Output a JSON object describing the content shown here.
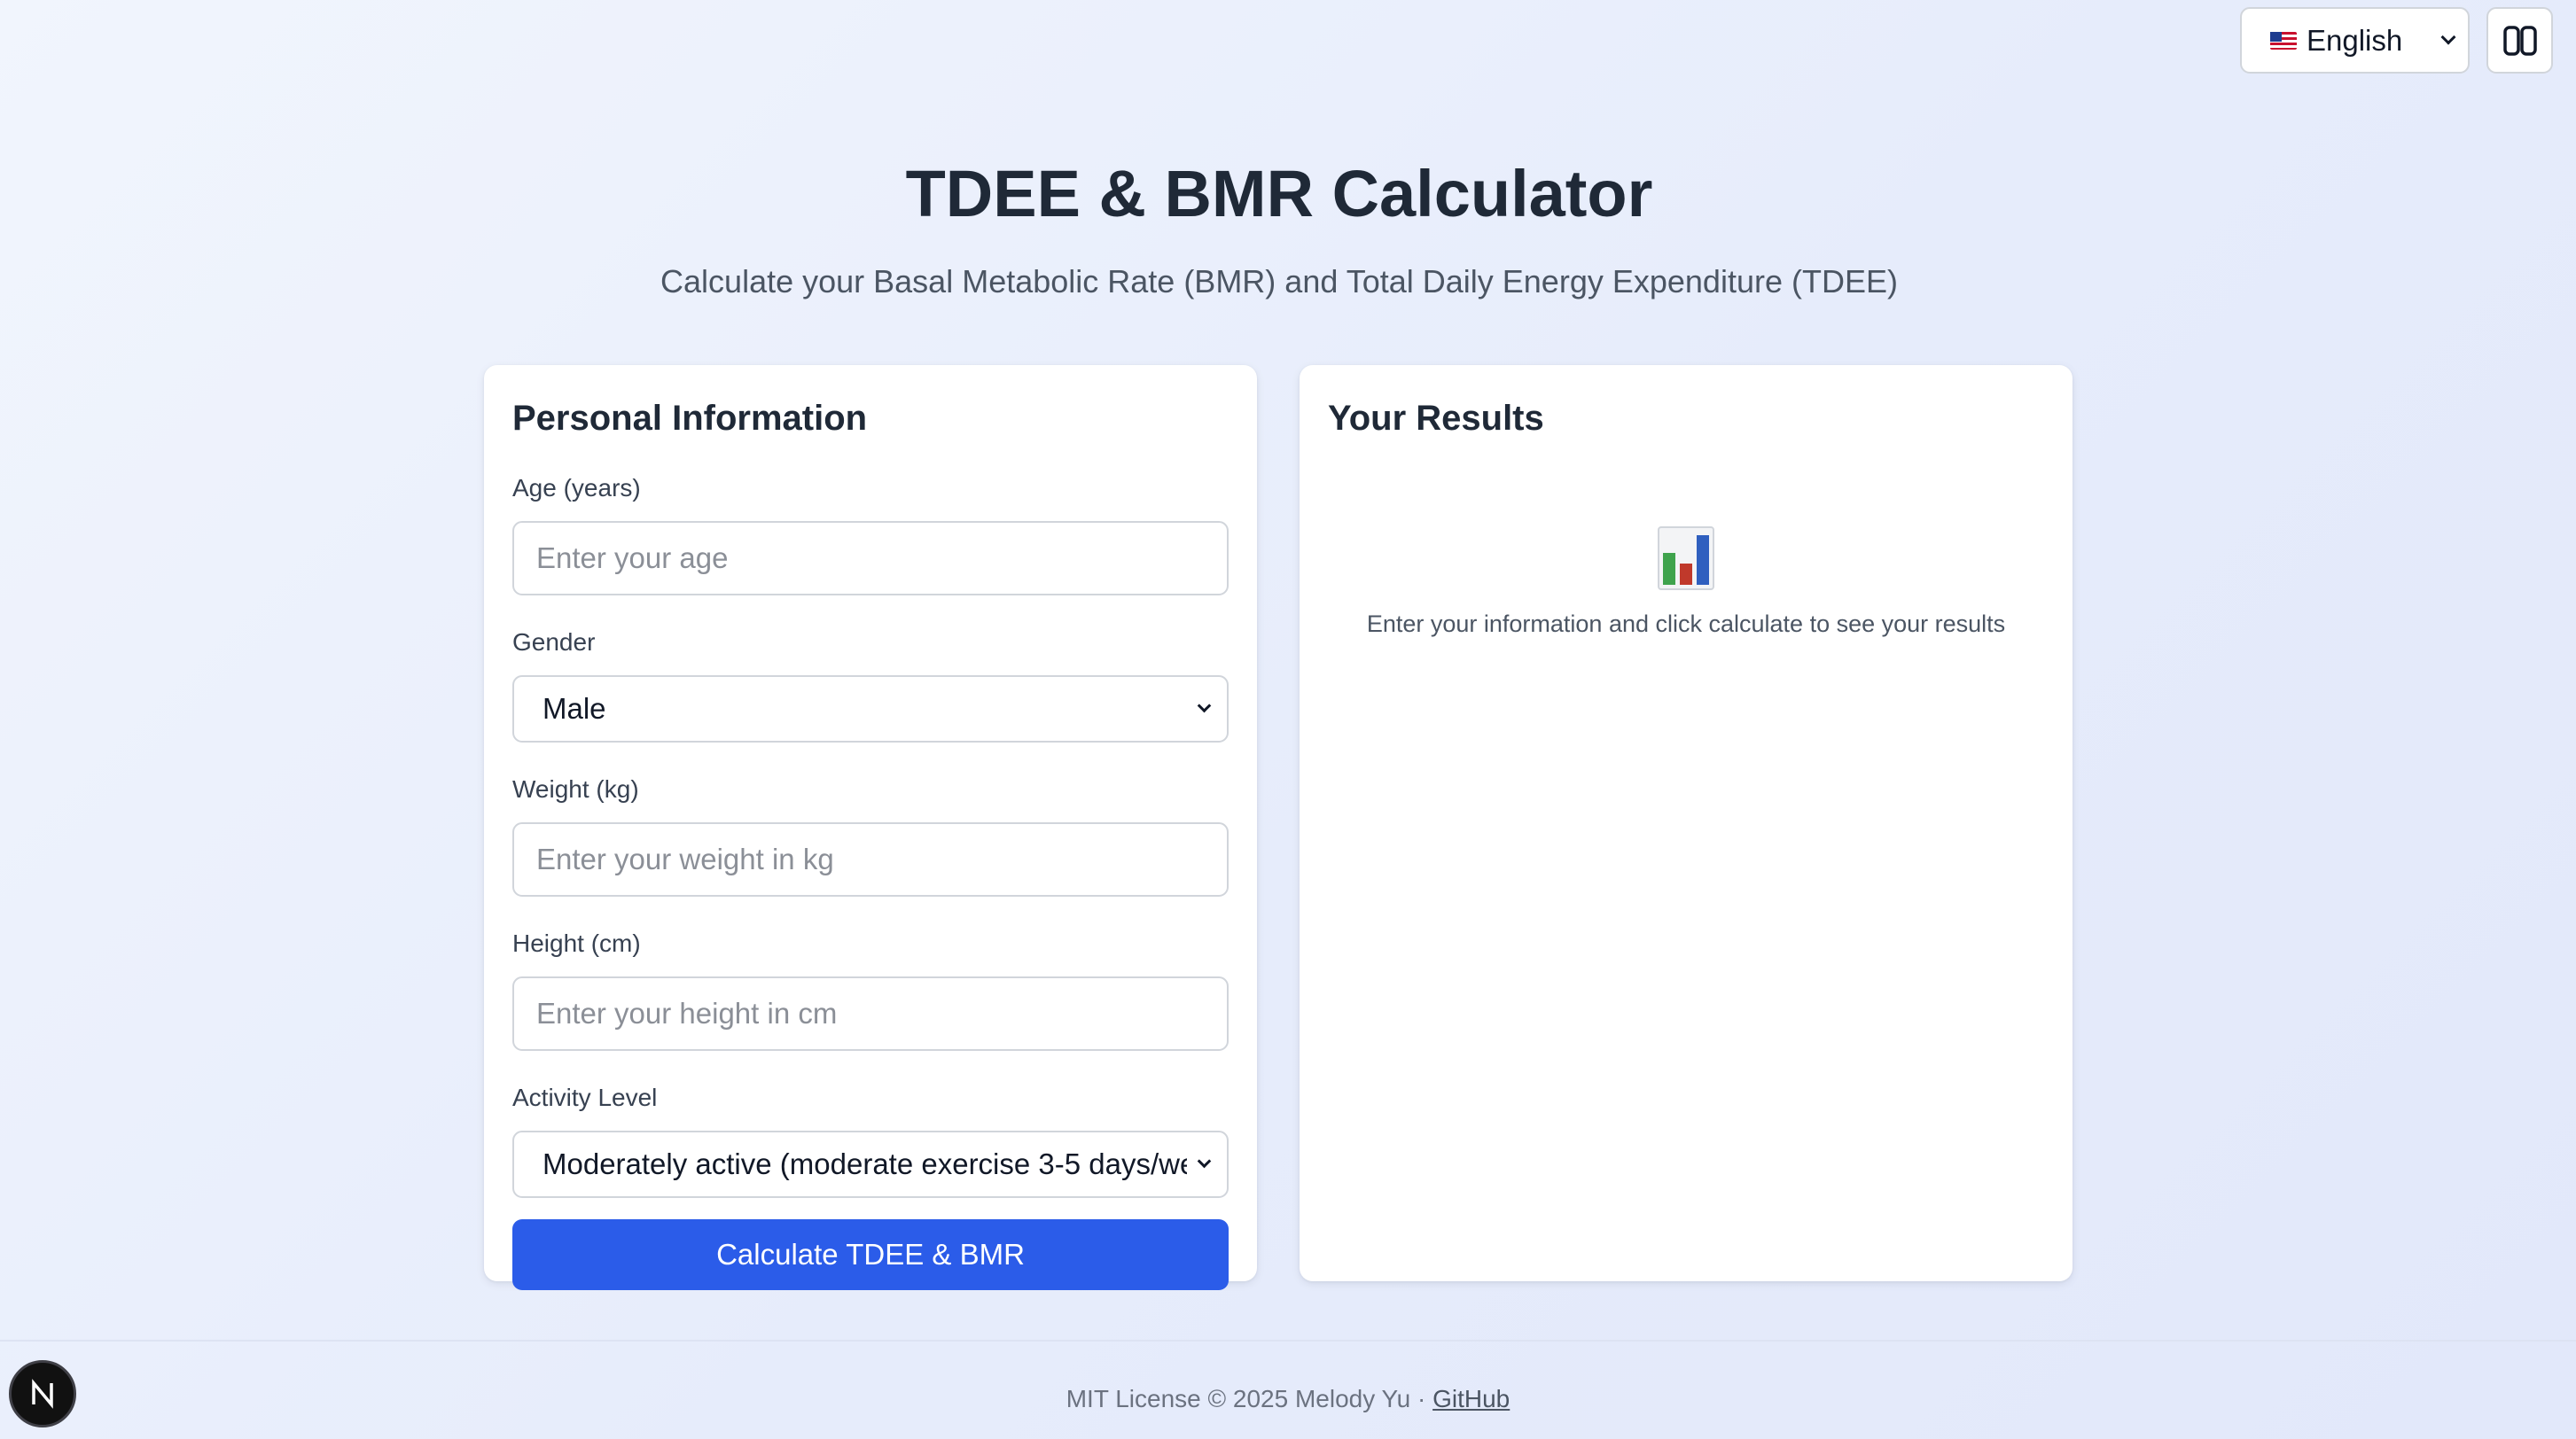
{
  "topbar": {
    "language": "English",
    "language_icon": "us-flag-icon",
    "layout_icon": "layout-columns-icon"
  },
  "header": {
    "title": "TDEE & BMR Calculator",
    "subtitle": "Calculate your Basal Metabolic Rate (BMR) and Total Daily Energy Expenditure (TDEE)"
  },
  "form": {
    "title": "Personal Information",
    "age_label": "Age (years)",
    "age_placeholder": "Enter your age",
    "gender_label": "Gender",
    "gender_value": "Male",
    "weight_label": "Weight (kg)",
    "weight_placeholder": "Enter your weight in kg",
    "height_label": "Height (cm)",
    "height_placeholder": "Enter your height in cm",
    "activity_label": "Activity Level",
    "activity_value": "Moderately active (moderate exercise 3-5 days/we",
    "submit_label": "Calculate TDEE & BMR",
    "submit_color": "#2b5ce9"
  },
  "results": {
    "title": "Your Results",
    "empty_icon": "bar-chart-icon",
    "empty_message": "Enter your information and click calculate to see your results"
  },
  "footer": {
    "text": "MIT License © 2025 Melody Yu · ",
    "link": "GitHub"
  },
  "badge": {
    "letter": "N"
  }
}
